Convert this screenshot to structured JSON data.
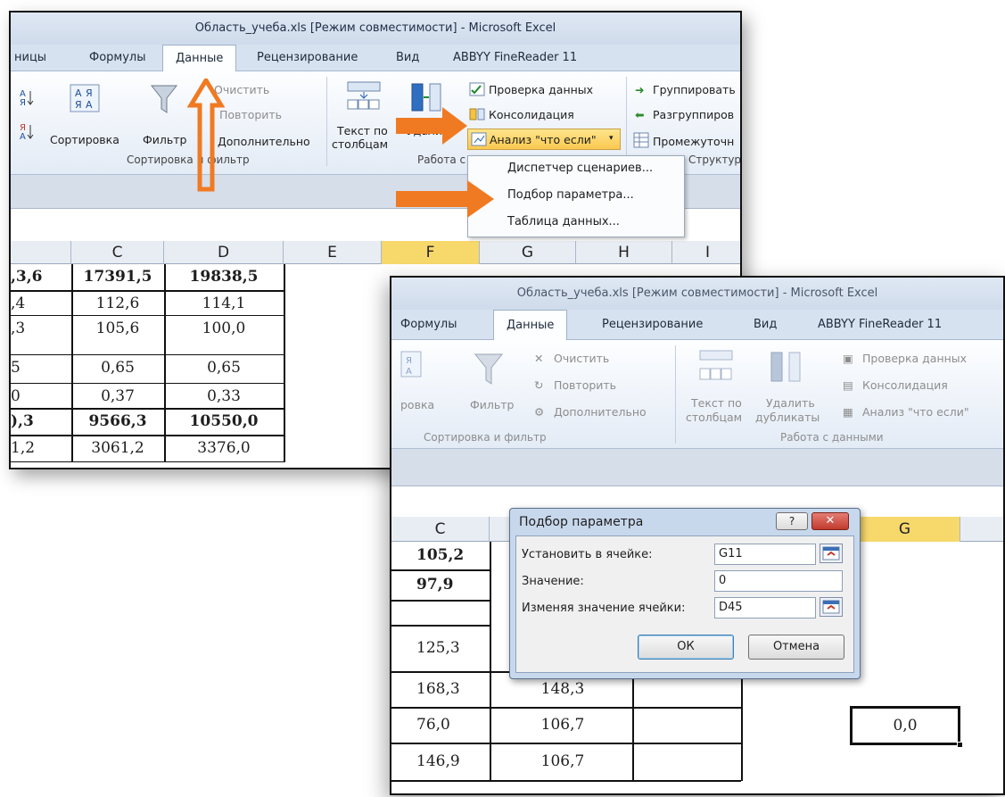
{
  "top": {
    "title": "Область_учеба.xls  [Режим совместимости]  -  Microsoft Excel",
    "tabs": [
      "ницы",
      "Формулы",
      "Данные",
      "Рецензирование",
      "Вид",
      "ABBYY FineReader 11"
    ],
    "ribbon": {
      "clear": "Очистить",
      "reapply": "Повторить",
      "advanced": "Дополнительно",
      "sort": "Сортировка",
      "filter": "Фильтр",
      "text_to_cols_1": "Текст по",
      "text_to_cols_2": "столбцам",
      "remove_1": "Удалить",
      "data_validation": "Проверка данных",
      "consolidate": "Консолидация",
      "what_if": "Анализ \"что если\"",
      "group": "Группировать",
      "ungroup": "Разгруппиров",
      "subtotal": "Промежуточн",
      "group_sort": "Сортировка и фильтр",
      "group_data": "Работа с",
      "group_outline": "Структура"
    },
    "menu": [
      "Диспетчер сценариев...",
      "Подбор параметра...",
      "Таблица данных..."
    ],
    "columns": [
      "C",
      "D",
      "E",
      "F",
      "G",
      "H",
      "I"
    ],
    "rows": [
      {
        "b": ",3,6",
        "c": "17391,5",
        "d": "19838,5",
        "bold": true
      },
      {
        "b": ",4",
        "c": "112,6",
        "d": "114,1",
        "bold": false
      },
      {
        "b": ",3",
        "c": "105,6",
        "d": "100,0",
        "bold": false
      },
      {
        "b": "5",
        "c": "0,65",
        "d": "0,65",
        "bold": false
      },
      {
        "b": "0",
        "c": "0,37",
        "d": "0,33",
        "bold": false
      },
      {
        "b": "),3",
        "c": "9566,3",
        "d": "10550,0",
        "bold": true
      },
      {
        "b": "1,2",
        "c": "3061,2",
        "d": "3376,0",
        "bold": false
      }
    ]
  },
  "bottom": {
    "title": "Область_учеба.xls  [Режим совместимости]  -  Microsoft Excel",
    "tabs": [
      "Формулы",
      "Данные",
      "Рецензирование",
      "Вид",
      "ABBYY FineReader 11"
    ],
    "ribbon": {
      "clear": "Очистить",
      "reapply": "Повторить",
      "advanced": "Дополнительно",
      "sort": "ровка",
      "filter": "Фильтр",
      "text_to_cols_1": "Текст по",
      "text_to_cols_2": "столбцам",
      "remove_1": "Удалить",
      "remove_2": "дубликаты",
      "data_validation": "Проверка данных",
      "consolidate": "Консолидация",
      "what_if": "Анализ \"что если\"",
      "group_sort": "Сортировка и фильтр",
      "group_data": "Работа с данными"
    },
    "columns": [
      "C",
      "G"
    ],
    "rows_c": [
      {
        "v": "105,2",
        "bold": true
      },
      {
        "v": "97,9",
        "bold": true
      },
      {
        "v": "",
        "bold": false
      },
      {
        "v": "125,3",
        "bold": false
      },
      {
        "v": "168,3",
        "bold": false
      },
      {
        "v": "76,0",
        "bold": false
      },
      {
        "v": "146,9",
        "bold": false
      }
    ],
    "rows_d": [
      "148,3",
      "106,7",
      "106,7"
    ],
    "g_value": "0,0",
    "dialog": {
      "title": "Подбор параметра",
      "set_cell_label": "Установить в ячейке:",
      "set_cell_value": "G11",
      "value_label": "Значение:",
      "value_value": "0",
      "changing_label": "Изменяя значение ячейки:",
      "changing_value": "D45",
      "ok": "ОК",
      "cancel": "Отмена",
      "help": "?"
    }
  },
  "colors": {
    "accent_arrow": "#f07a22",
    "selected_col": "#f7d86b",
    "close_btn": "#c9423a"
  }
}
